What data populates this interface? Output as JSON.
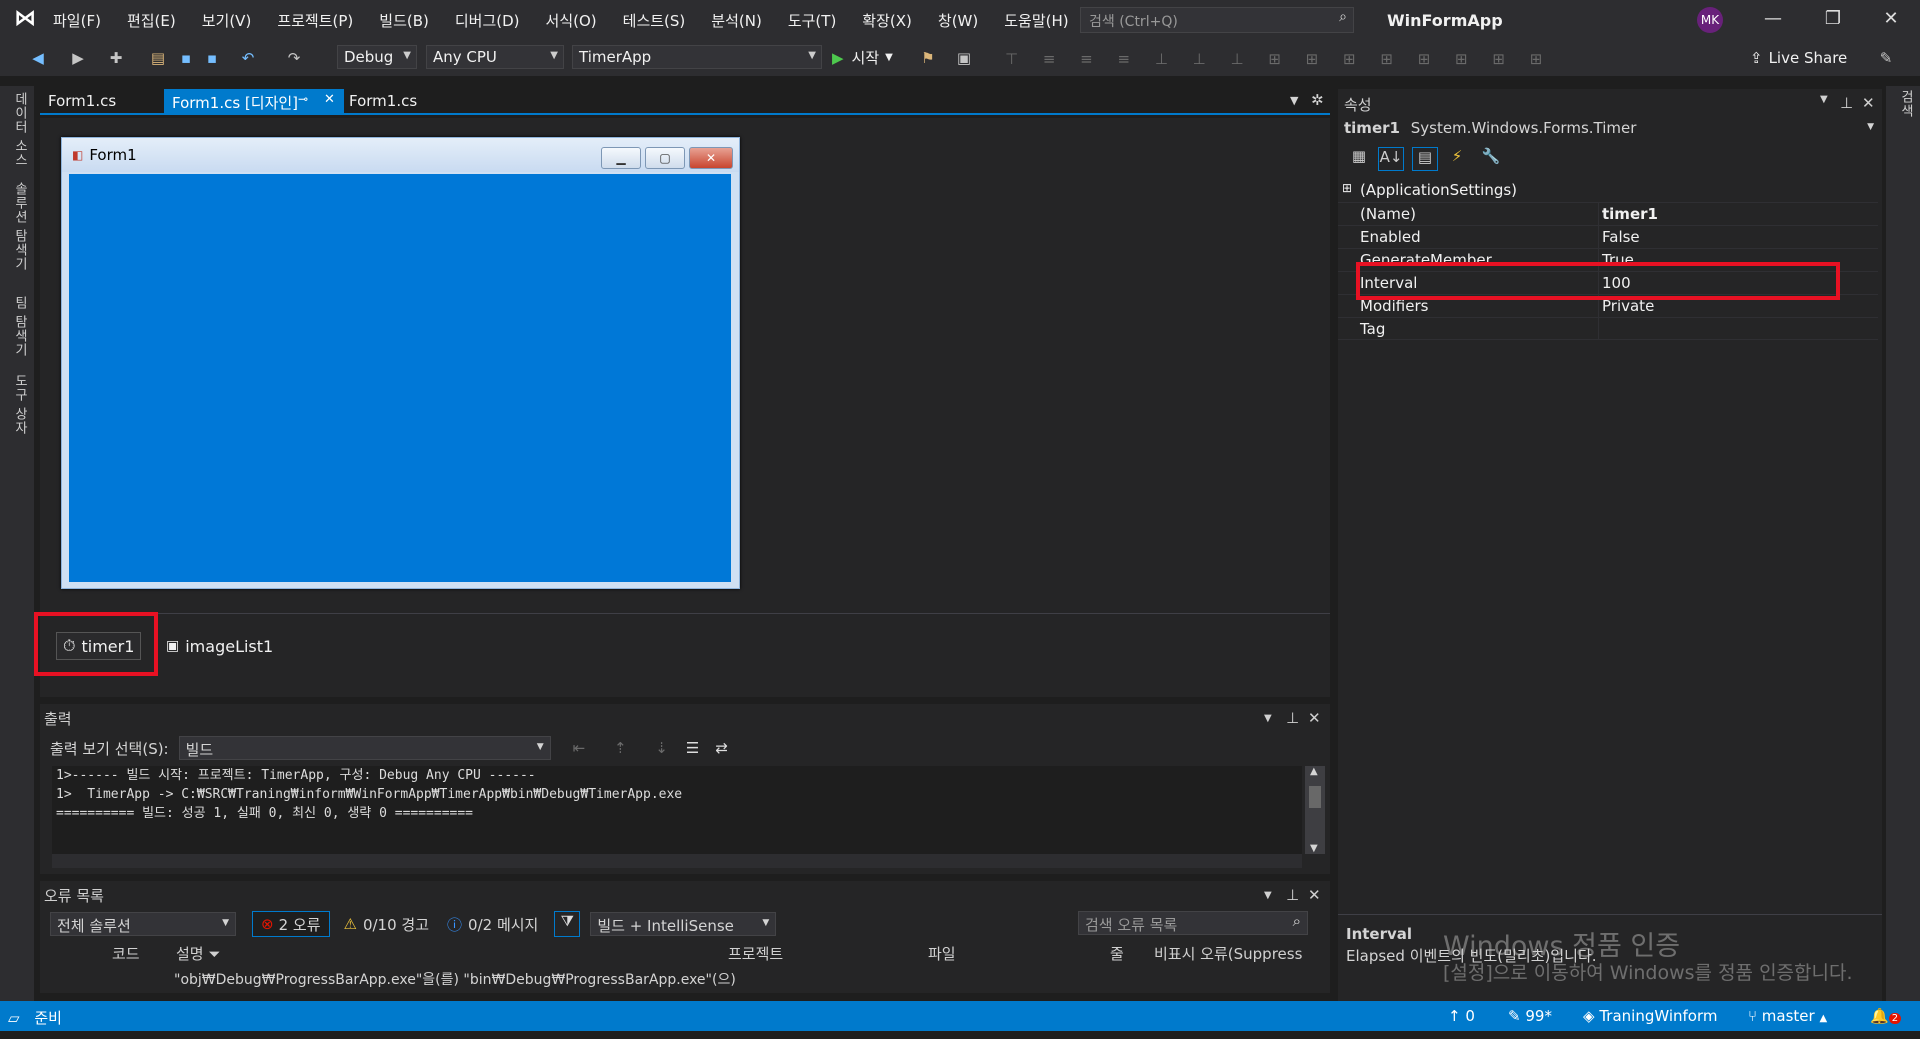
{
  "menu": [
    "파일(F)",
    "편집(E)",
    "보기(V)",
    "프로젝트(P)",
    "빌드(B)",
    "디버그(D)",
    "서식(O)",
    "테스트(S)",
    "분석(N)",
    "도구(T)",
    "확장(X)",
    "창(W)",
    "도움말(H)"
  ],
  "search_placeholder": "검색 (Ctrl+Q)",
  "app_name": "WinFormApp",
  "avatar": "MK",
  "toolbar": {
    "config": "Debug",
    "platform": "Any CPU",
    "project": "TimerApp",
    "start": "시작",
    "live_share": "Live Share"
  },
  "left_tabs": [
    "데이터 소스",
    "솔루션 탐색기",
    "팀 탐색기",
    "도구 상자"
  ],
  "right_tabs": [
    "검색"
  ],
  "doc_tabs": [
    "Form1.cs",
    "Form1.cs [디자인]",
    "Form1.cs"
  ],
  "form": {
    "title": "Form1"
  },
  "tray": {
    "components": [
      "timer1",
      "imageList1"
    ]
  },
  "output": {
    "title": "출력",
    "show_label": "출력 보기 선택(S):",
    "source": "빌드",
    "lines": [
      "1>------ 빌드 시작: 프로젝트: TimerApp, 구성: Debug Any CPU ------",
      "1>  TimerApp -> C:₩SRC₩Traning₩inform₩WinFormApp₩TimerApp₩bin₩Debug₩TimerApp.exe",
      "========== 빌드: 성공 1, 실패 0, 최신 0, 생략 0 =========="
    ]
  },
  "error_list": {
    "title": "오류 목록",
    "scope": "전체 솔루션",
    "errors": "2 오류",
    "warnings": "0/10 경고",
    "messages": "0/2 메시지",
    "build_filter": "빌드 + IntelliSense",
    "search_placeholder": "검색 오류 목록",
    "columns": [
      "코드",
      "설명",
      "프로젝트",
      "파일",
      "줄",
      "비표시 오류(Suppress"
    ],
    "row_desc": "\"obj₩Debug₩ProgressBarApp.exe\"을(를) \"bin₩Debug₩ProgressBarApp.exe\"(으)"
  },
  "properties": {
    "title": "속성",
    "object_name": "timer1",
    "object_type": "System.Windows.Forms.Timer",
    "rows": [
      {
        "k": "(ApplicationSettings)",
        "v": ""
      },
      {
        "k": "(Name)",
        "v": "timer1"
      },
      {
        "k": "Enabled",
        "v": "False"
      },
      {
        "k": "GenerateMember",
        "v": "True"
      },
      {
        "k": "Interval",
        "v": "100"
      },
      {
        "k": "Modifiers",
        "v": "Private"
      },
      {
        "k": "Tag",
        "v": ""
      }
    ],
    "desc_title": "Interval",
    "desc_text": "Elapsed 이벤트의 빈도(밀리초)입니다."
  },
  "watermark": {
    "line1": "Windows 정품 인증",
    "line2": "[설정]으로 이동하여 Windows를 정품 인증합니다."
  },
  "status": {
    "ready": "준비",
    "up": "0",
    "edits": "99*",
    "repo": "TraningWinform",
    "branch": "master",
    "notif": "2"
  }
}
